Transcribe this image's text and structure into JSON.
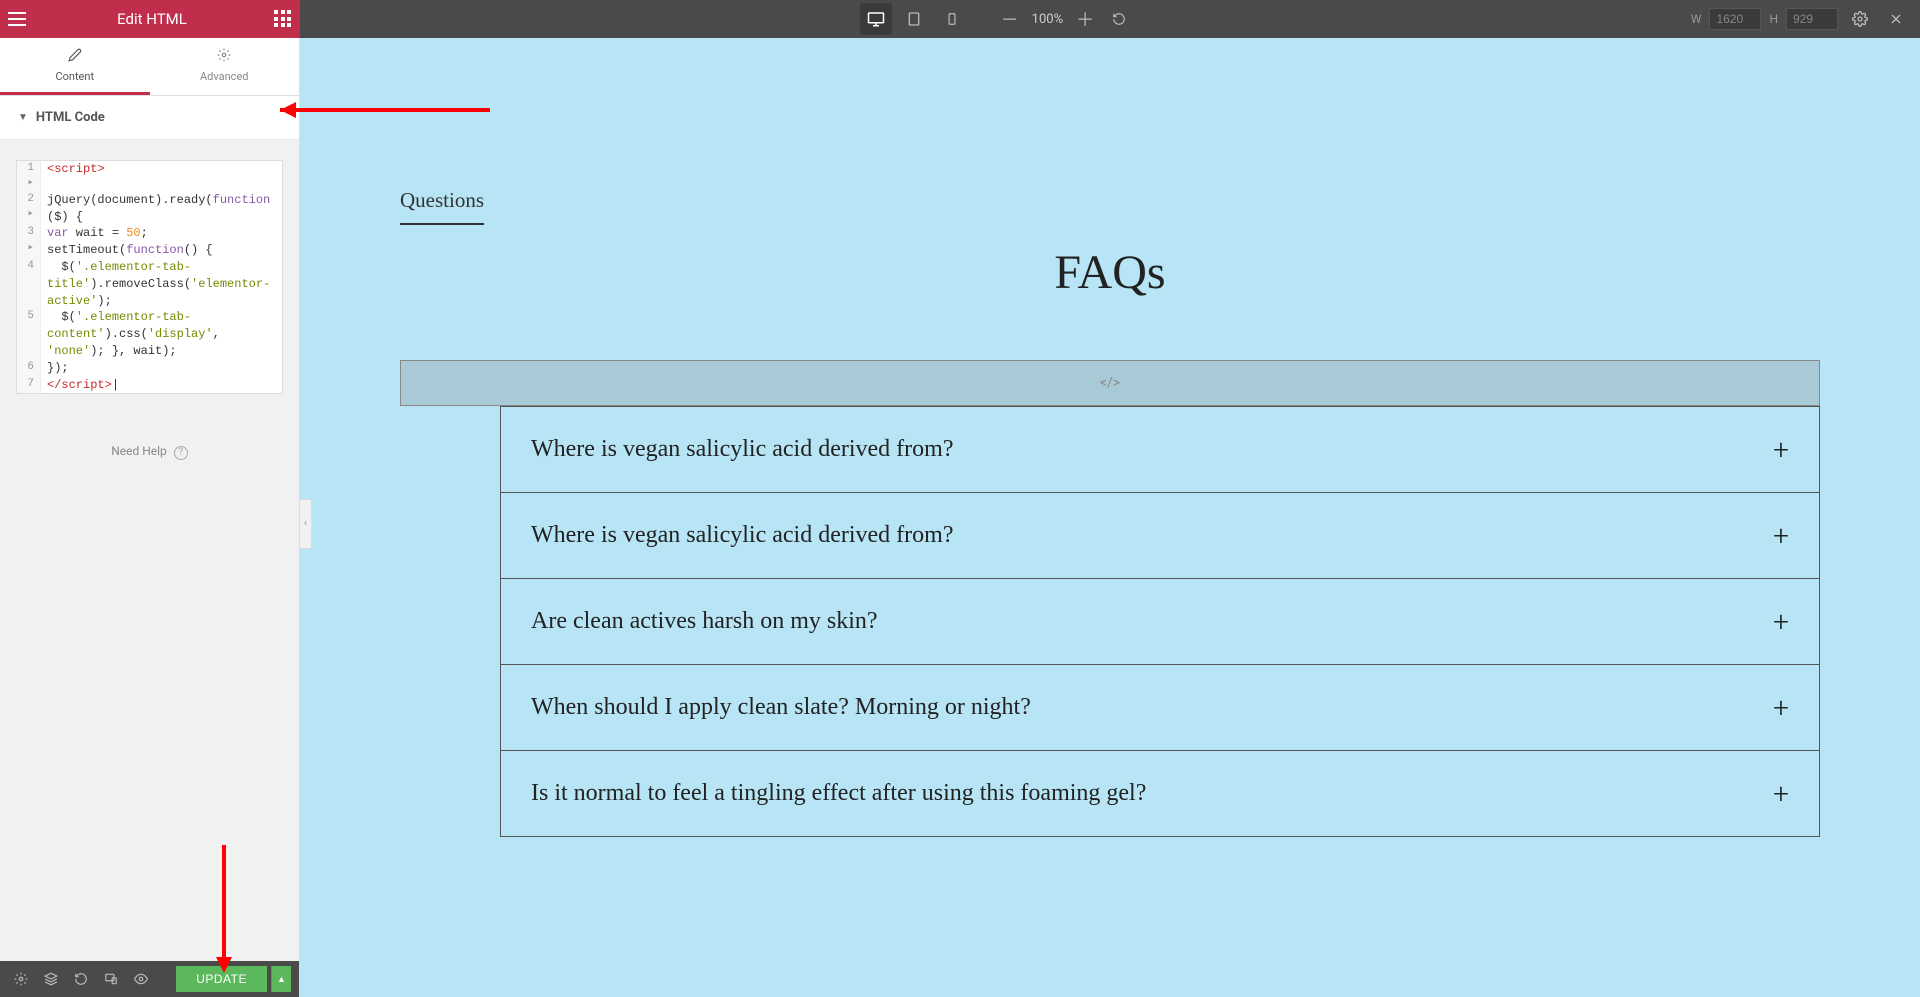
{
  "topbar": {
    "title": "Edit HTML",
    "zoom": "100%",
    "width_label": "W",
    "width_value": "1620",
    "height_label": "H",
    "height_value": "929"
  },
  "tabs": {
    "content": "Content",
    "advanced": "Advanced"
  },
  "section": {
    "title": "HTML Code"
  },
  "code": {
    "lines": [
      {
        "num": "1",
        "marker": "▸",
        "content": "<script>"
      },
      {
        "num": "2",
        "marker": "▸",
        "content": "jQuery(document).ready(function ($) {"
      },
      {
        "num": "3",
        "marker": "▸",
        "content": "var wait = 50; setTimeout(function() {"
      },
      {
        "num": "4",
        "marker": "",
        "content": "$('.elementor-tab-title').removeClass('elementor-active');"
      },
      {
        "num": "5",
        "marker": "",
        "content": "$('.elementor-tab-content').css('display', 'none'); }, wait);"
      },
      {
        "num": "6",
        "marker": "",
        "content": "});"
      },
      {
        "num": "7",
        "marker": "",
        "content": "</script>"
      }
    ]
  },
  "help": {
    "text": "Need Help",
    "icon": "?"
  },
  "footer": {
    "update": "UPDATE"
  },
  "canvas": {
    "questions_label": "Questions",
    "faqs_title": "FAQs",
    "widget_placeholder": "</>"
  },
  "accordion": [
    "Where is vegan salicylic acid derived from?",
    "Where is vegan salicylic acid derived from?",
    "Are clean actives harsh on my skin?",
    "When should I apply clean slate? Morning or night?",
    "Is it normal to feel a tingling effect after using this foaming gel?"
  ]
}
